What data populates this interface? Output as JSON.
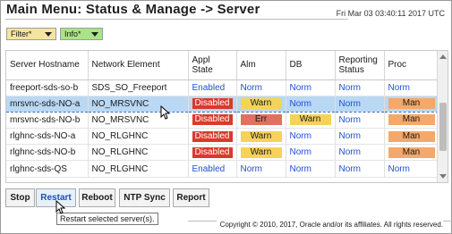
{
  "header": {
    "title": "Main Menu: Status & Manage -> Server",
    "timestamp": "Fri Mar 03 03:40:11 2017 UTC"
  },
  "filters": {
    "filter_label": "Filter*",
    "info_label": "Info*"
  },
  "table": {
    "columns": [
      "Server Hostname",
      "Network Element",
      "Appl State",
      "Alm",
      "DB",
      "Reporting Status",
      "Proc"
    ],
    "rows": [
      {
        "hostname": "freeport-sds-so-b",
        "network_element": "SDS_SO_Freeport",
        "appl_state": "Enabled",
        "alm": "Norm",
        "db": "Norm",
        "reporting": "Norm",
        "proc": "Norm",
        "selected": false
      },
      {
        "hostname": "mrsvnc-sds-NO-a",
        "network_element": "NO_MRSVNC",
        "appl_state": "Disabled",
        "alm": "Warn",
        "db": "Norm",
        "reporting": "Norm",
        "proc": "Man",
        "selected": true
      },
      {
        "hostname": "mrsvnc-sds-NO-b",
        "network_element": "NO_MRSVNC",
        "appl_state": "Disabled",
        "alm": "Err",
        "db": "Warn",
        "reporting": "Norm",
        "proc": "Man",
        "selected": false
      },
      {
        "hostname": "rlghnc-sds-NO-a",
        "network_element": "NO_RLGHNC",
        "appl_state": "Disabled",
        "alm": "Warn",
        "db": "Norm",
        "reporting": "Norm",
        "proc": "Man",
        "selected": false
      },
      {
        "hostname": "rlghnc-sds-NO-b",
        "network_element": "NO_RLGHNC",
        "appl_state": "Disabled",
        "alm": "Warn",
        "db": "Norm",
        "reporting": "Norm",
        "proc": "Man",
        "selected": false
      },
      {
        "hostname": "rlghnc-sds-QS",
        "network_element": "NO_RLGHNC",
        "appl_state": "Enabled",
        "alm": "Norm",
        "db": "Norm",
        "reporting": "Norm",
        "proc": "Norm",
        "selected": false
      }
    ]
  },
  "actions": {
    "stop": "Stop",
    "restart": "Restart",
    "reboot": "Reboot",
    "ntp_sync": "NTP Sync",
    "report": "Report"
  },
  "tooltip": "Restart selected server(s).",
  "footer": {
    "copyright": "Copyright © 2010, 2017, Oracle and/or its affiliates. All rights reserved."
  },
  "colors": {
    "disabled": "#d83a2e",
    "warn": "#f5d35a",
    "err": "#e07060",
    "man": "#f4a86a",
    "norm_text": "#1f4fd0",
    "selected_row": "#b9d8f4"
  }
}
